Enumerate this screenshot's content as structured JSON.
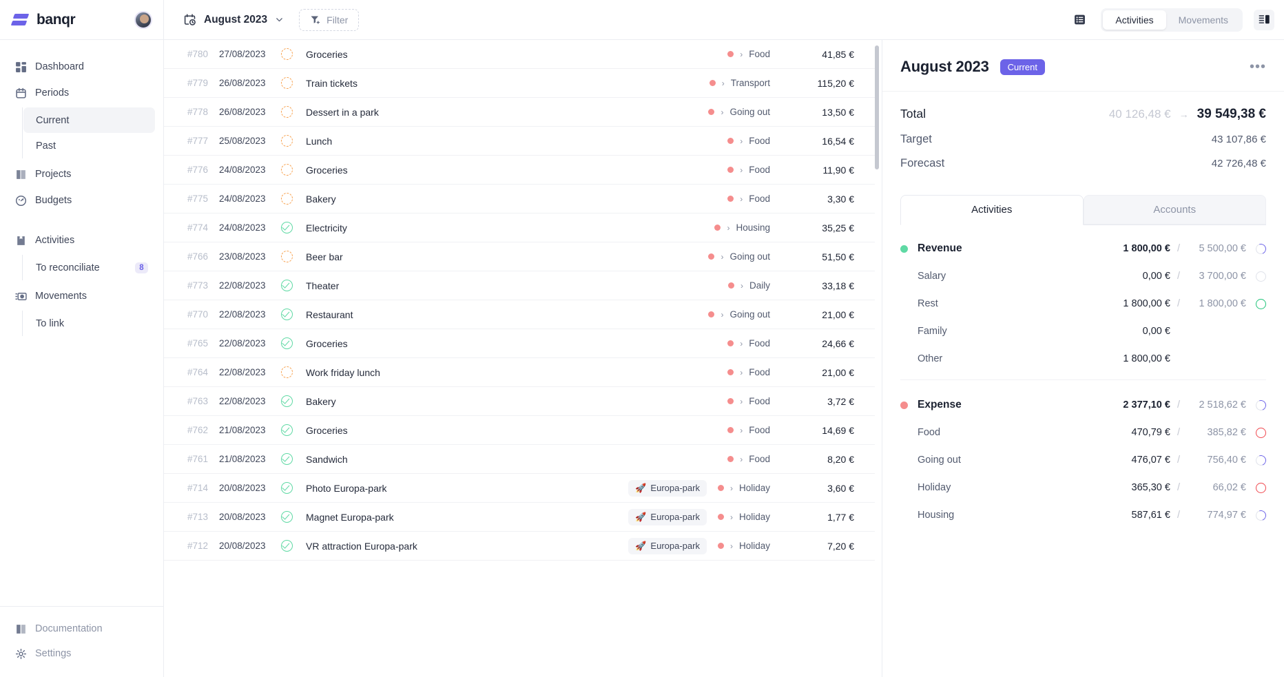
{
  "sidebar": {
    "brand": "banqr",
    "items": [
      {
        "label": "Dashboard",
        "icon": "dashboard-icon"
      },
      {
        "label": "Periods",
        "icon": "calendar-icon"
      },
      {
        "label": "Projects",
        "icon": "projects-icon"
      },
      {
        "label": "Budgets",
        "icon": "gauge-icon"
      },
      {
        "label": "Activities",
        "icon": "book-icon"
      },
      {
        "label": "Movements",
        "icon": "movements-icon"
      }
    ],
    "periods_sub": [
      {
        "label": "Current",
        "active": true
      },
      {
        "label": "Past",
        "active": false
      }
    ],
    "activities_sub": [
      {
        "label": "To reconciliate",
        "badge": "8"
      }
    ],
    "movements_sub": [
      {
        "label": "To link",
        "badge": ""
      }
    ],
    "footer": [
      {
        "label": "Documentation",
        "icon": "documentation-icon"
      },
      {
        "label": "Settings",
        "icon": "gear-icon"
      }
    ]
  },
  "toolbar": {
    "period": "August 2023",
    "filter_label": "Filter",
    "list_icon": "list-view-icon",
    "panel_icon": "side-panel-icon",
    "segments": [
      {
        "label": "Activities",
        "active": true
      },
      {
        "label": "Movements",
        "active": false
      }
    ]
  },
  "activities": [
    {
      "id": "#780",
      "date": "27/08/2023",
      "status": "pending",
      "label": "Groceries",
      "project": "",
      "category": "Food",
      "amount": "41,85 €"
    },
    {
      "id": "#779",
      "date": "26/08/2023",
      "status": "pending",
      "label": "Train tickets",
      "project": "",
      "category": "Transport",
      "amount": "115,20 €"
    },
    {
      "id": "#778",
      "date": "26/08/2023",
      "status": "pending",
      "label": "Dessert in a park",
      "project": "",
      "category": "Going out",
      "amount": "13,50 €"
    },
    {
      "id": "#777",
      "date": "25/08/2023",
      "status": "pending",
      "label": "Lunch",
      "project": "",
      "category": "Food",
      "amount": "16,54 €"
    },
    {
      "id": "#776",
      "date": "24/08/2023",
      "status": "pending",
      "label": "Groceries",
      "project": "",
      "category": "Food",
      "amount": "11,90 €"
    },
    {
      "id": "#775",
      "date": "24/08/2023",
      "status": "pending",
      "label": "Bakery",
      "project": "",
      "category": "Food",
      "amount": "3,30 €"
    },
    {
      "id": "#774",
      "date": "24/08/2023",
      "status": "done",
      "label": "Electricity",
      "project": "",
      "category": "Housing",
      "amount": "35,25 €"
    },
    {
      "id": "#766",
      "date": "23/08/2023",
      "status": "pending",
      "label": "Beer bar",
      "project": "",
      "category": "Going out",
      "amount": "51,50 €"
    },
    {
      "id": "#773",
      "date": "22/08/2023",
      "status": "done",
      "label": "Theater",
      "project": "",
      "category": "Daily",
      "amount": "33,18 €"
    },
    {
      "id": "#770",
      "date": "22/08/2023",
      "status": "done",
      "label": "Restaurant",
      "project": "",
      "category": "Going out",
      "amount": "21,00 €"
    },
    {
      "id": "#765",
      "date": "22/08/2023",
      "status": "done",
      "label": "Groceries",
      "project": "",
      "category": "Food",
      "amount": "24,66 €"
    },
    {
      "id": "#764",
      "date": "22/08/2023",
      "status": "pending",
      "label": "Work friday lunch",
      "project": "",
      "category": "Food",
      "amount": "21,00 €"
    },
    {
      "id": "#763",
      "date": "22/08/2023",
      "status": "done",
      "label": "Bakery",
      "project": "",
      "category": "Food",
      "amount": "3,72 €"
    },
    {
      "id": "#762",
      "date": "21/08/2023",
      "status": "done",
      "label": "Groceries",
      "project": "",
      "category": "Food",
      "amount": "14,69 €"
    },
    {
      "id": "#761",
      "date": "21/08/2023",
      "status": "done",
      "label": "Sandwich",
      "project": "",
      "category": "Food",
      "amount": "8,20 €"
    },
    {
      "id": "#714",
      "date": "20/08/2023",
      "status": "done",
      "label": "Photo Europa-park",
      "project": "Europa-park",
      "category": "Holiday",
      "amount": "3,60 €"
    },
    {
      "id": "#713",
      "date": "20/08/2023",
      "status": "done",
      "label": "Magnet Europa-park",
      "project": "Europa-park",
      "category": "Holiday",
      "amount": "1,77 €"
    },
    {
      "id": "#712",
      "date": "20/08/2023",
      "status": "done",
      "label": "VR attraction Europa-park",
      "project": "Europa-park",
      "category": "Holiday",
      "amount": "7,20 €"
    }
  ],
  "project_icon": "🚀",
  "panel": {
    "title": "August 2023",
    "badge": "Current",
    "more_icon": "ellipsis-icon",
    "totals": {
      "total_label": "Total",
      "total_old": "40 126,48 €",
      "total_arrow": "→",
      "total_new": "39 549,38 €",
      "target_label": "Target",
      "target_value": "43 107,86 €",
      "forecast_label": "Forecast",
      "forecast_value": "42 726,48 €"
    },
    "tabs": [
      {
        "label": "Activities",
        "active": true
      },
      {
        "label": "Accounts",
        "active": false
      }
    ],
    "groups": [
      {
        "name": "Revenue",
        "color": "#5fd9a4",
        "actual": "1 800,00 €",
        "target": "5 500,00 €",
        "progress": "partial",
        "rows": [
          {
            "name": "Salary",
            "actual": "0,00 €",
            "target": "3 700,00 €",
            "progress": "empty"
          },
          {
            "name": "Rest",
            "actual": "1 800,00 €",
            "target": "1 800,00 €",
            "progress": "full-green"
          },
          {
            "name": "Family",
            "actual": "0,00 €",
            "target": "",
            "progress": "none"
          },
          {
            "name": "Other",
            "actual": "1 800,00 €",
            "target": "",
            "progress": "none"
          }
        ]
      },
      {
        "name": "Expense",
        "color": "#f58d8d",
        "actual": "2 377,10 €",
        "target": "2 518,62 €",
        "progress": "partial",
        "rows": [
          {
            "name": "Food",
            "actual": "470,79 €",
            "target": "385,82 €",
            "progress": "full-red"
          },
          {
            "name": "Going out",
            "actual": "476,07 €",
            "target": "756,40 €",
            "progress": "partial"
          },
          {
            "name": "Holiday",
            "actual": "365,30 €",
            "target": "66,02 €",
            "progress": "full-red"
          },
          {
            "name": "Housing",
            "actual": "587,61 €",
            "target": "774,97 €",
            "progress": "partial"
          }
        ]
      }
    ]
  }
}
